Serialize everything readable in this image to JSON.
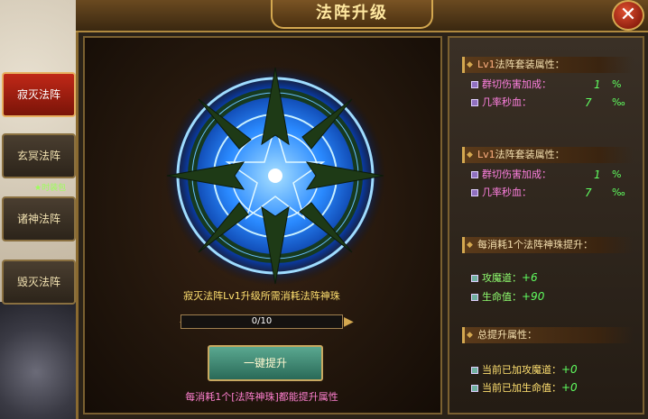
{
  "window": {
    "title": "法阵升级",
    "close_label": "✕"
  },
  "tabs": [
    {
      "label": "寂灭法阵",
      "active": true
    },
    {
      "label": "玄冥法阵",
      "active": false
    },
    {
      "label": "诸神法阵",
      "active": false
    },
    {
      "label": "毁灭法阵",
      "active": false
    }
  ],
  "background_note": "★时装包",
  "center": {
    "requirement_text": "寂灭法阵Lv1升级所需消耗法阵神珠",
    "progress": {
      "current": 0,
      "max": 10,
      "text": "0/10"
    },
    "upgrade_button": "一键提升",
    "hint_text": "每消耗1个[法阵神珠]都能提升属性"
  },
  "right_panel": {
    "set1": {
      "level": "Lv1",
      "title": "法阵套装属性：",
      "attrs": [
        {
          "label": "群切伤害加成：",
          "value": "1",
          "unit": "%"
        },
        {
          "label": "几率秒血：",
          "value": "7",
          "unit": "‰"
        }
      ]
    },
    "set2": {
      "level": "Lv1",
      "title": "法阵套装属性：",
      "attrs": [
        {
          "label": "群切伤害加成：",
          "value": "1",
          "unit": "%"
        },
        {
          "label": "几率秒血：",
          "value": "7",
          "unit": "‰"
        }
      ]
    },
    "per_consume": {
      "title": "每消耗1个法阵神珠提升：",
      "attrs": [
        {
          "label": "攻魔道：",
          "value": "+6"
        },
        {
          "label": "生命值：",
          "value": "+90"
        }
      ]
    },
    "total": {
      "title": "总提升属性：",
      "attrs": [
        {
          "label": "当前已加攻魔道：",
          "value": "+0"
        },
        {
          "label": "当前已加生命值：",
          "value": "+0"
        }
      ]
    }
  },
  "colors": {
    "accent_gold": "#d4a850",
    "active_tab": "#c02818",
    "value_green": "#60ff60",
    "magic_blue": "#3aa0ff"
  },
  "icons": {
    "close": "close-icon",
    "magic_circle": "magic-circle-icon"
  }
}
